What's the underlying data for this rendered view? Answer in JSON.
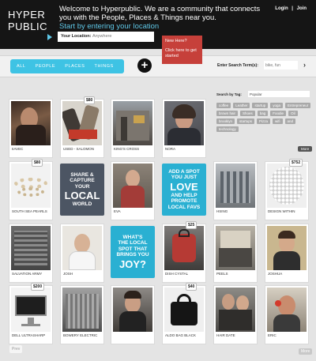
{
  "header": {
    "logo_line1": "HYPER",
    "logo_line2": "PUBLIC",
    "tagline": "Welcome to Hyperpublic. We are a community that connects you with the People, Places & Things near you.",
    "subtagline": "Start by entering your location",
    "login": "Login",
    "separator": "|",
    "join": "Join",
    "location_label": "Your Location:",
    "location_placeholder": "Anywhere",
    "new_here_question": "New Here?",
    "new_here_text": "Click here to get started"
  },
  "filterbar": {
    "tabs": [
      "ALL",
      "PEOPLE",
      "PLACES",
      "THINGS"
    ],
    "add_symbol": "+",
    "search_label": "Enter Search Term(s):",
    "search_placeholder": "bike, fun",
    "search_go": "›"
  },
  "tagpanel": {
    "label": "Search by Tag:",
    "value": "Popular",
    "tags": [
      "coffee",
      "Leather",
      "startup",
      "yoga",
      "Entrepreneur",
      "brown hair",
      "Shoes",
      "bag",
      "Foodie",
      "Oil",
      "brooklyn",
      "startups",
      "Pizza",
      "wifi",
      "and",
      "technology"
    ],
    "more": "More"
  },
  "tiles": [
    {
      "caption": "IIAVEC",
      "price": ""
    },
    {
      "caption": "USED - SALOMON",
      "price": "$80"
    },
    {
      "caption": "KING'S CROSS",
      "price": ""
    },
    {
      "caption": "NORA",
      "price": ""
    },
    {
      "caption": "SOUTH SEA PEARLS",
      "price": "$80"
    },
    {
      "caption": "EVA",
      "price": ""
    },
    {
      "caption": "HSING",
      "price": ""
    },
    {
      "caption": "DESIGN WITHIN",
      "price": "$752"
    },
    {
      "caption": "SALVATION ARMY",
      "price": ""
    },
    {
      "caption": "JOSH",
      "price": ""
    },
    {
      "caption": "DISH CYSTAL",
      "price": "$25"
    },
    {
      "caption": "PEELS",
      "price": ""
    },
    {
      "caption": "JOSHUA",
      "price": ""
    },
    {
      "caption": "DELL ULTRASHARP",
      "price": "$200"
    },
    {
      "caption": "BOWERY ELECTRIC",
      "price": ""
    },
    {
      "caption": "",
      "price": ""
    },
    {
      "caption": "ALDO BAG BLACK",
      "price": "$40"
    },
    {
      "caption": "HAIR DATE",
      "price": ""
    },
    {
      "caption": "ERIC",
      "price": ""
    }
  ],
  "promos": {
    "share": {
      "line1": "SHARE &",
      "line2": "CAPTURE",
      "line3": "YOUR",
      "big": "LOCAL",
      "line4": "WORLD"
    },
    "love": {
      "line1": "ADD A SPOT",
      "line2": "YOU JUST",
      "big": "LOVE",
      "line3": "AND HELP",
      "line4": "PROMOTE",
      "line5": "LOCAL FAVS"
    },
    "joy": {
      "line1": "WHAT'S",
      "line2": "THE LOCAL",
      "line3": "SPOT THAT",
      "line4": "BRINGS YOU",
      "big": "JOY?"
    }
  },
  "footer": {
    "prev": "Prev",
    "more": "More"
  }
}
